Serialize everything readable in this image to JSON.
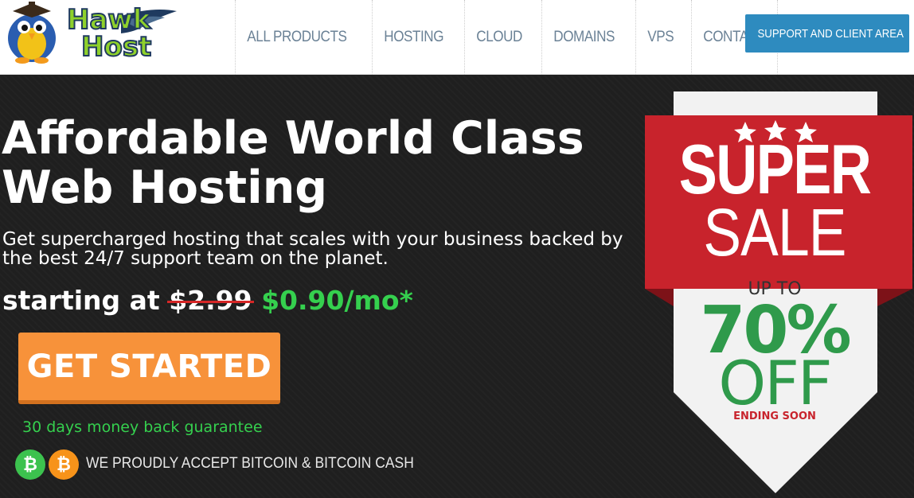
{
  "brand": {
    "logo_line1": "Hawk",
    "logo_line2": "Host"
  },
  "nav": {
    "items": [
      {
        "label": "ALL PRODUCTS"
      },
      {
        "label": "HOSTING"
      },
      {
        "label": "CLOUD"
      },
      {
        "label": "DOMAINS"
      },
      {
        "label": "VPS"
      },
      {
        "label": "CONTACT"
      }
    ],
    "support_label": "SUPPORT AND CLIENT AREA"
  },
  "hero": {
    "headline_line1": "Affordable World Class",
    "headline_line2": "Web Hosting",
    "subline1": "Get supercharged hosting that scales with your business backed by",
    "subline2": "the best 24/7 support team on the planet.",
    "price_prefix": "starting at",
    "old_price": "$2.99",
    "new_price": "$0.90/mo*",
    "cta_label": "GET STARTED",
    "guarantee": "30 days money back guarantee",
    "accept_text": "WE PROUDLY ACCEPT BITCOIN & BITCOIN CASH"
  },
  "banner": {
    "super": "SUPER",
    "sale": "SALE",
    "up_to": "UP TO",
    "percent": "70%",
    "off": "OFF",
    "ending": "ENDING SOON"
  },
  "colors": {
    "accent_blue": "#2e8bbf",
    "cta_orange": "#f7923a",
    "price_green": "#35d04e",
    "banner_red": "#c8232c",
    "banner_green": "#2f9a4b"
  }
}
